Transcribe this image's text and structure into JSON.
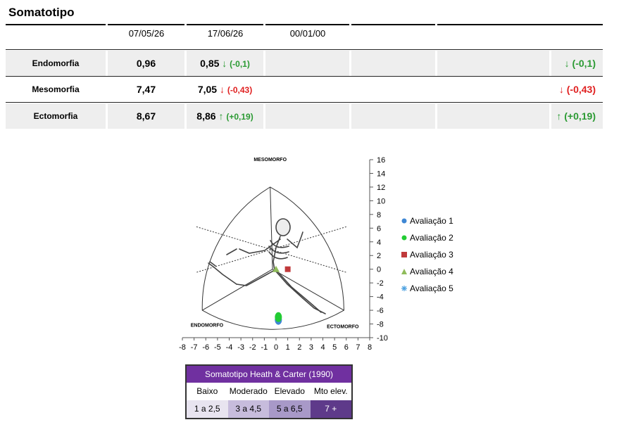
{
  "title": "Somatotipo",
  "dates": [
    "07/05/26",
    "17/06/26",
    "00/01/00"
  ],
  "rows": [
    {
      "label": "Endomorfia",
      "v1": "0,96",
      "v2": "0,85",
      "v2_arrow": "↓",
      "v2_delta": "(-0,1)",
      "final_arrow": "↓",
      "final_delta": "(-0,1)"
    },
    {
      "label": "Mesomorfia",
      "v1": "7,47",
      "v2": "7,05",
      "v2_arrow": "↓",
      "v2_delta": "(-0,43)",
      "final_arrow": "↓",
      "final_delta": "(-0,43)"
    },
    {
      "label": "Ectomorfia",
      "v1": "8,67",
      "v2": "8,86",
      "v2_arrow": "↑",
      "v2_delta": "(+0,19)",
      "final_arrow": "↑",
      "final_delta": "(+0,19)"
    }
  ],
  "colors": {
    "green": "#2a9a32",
    "red": "#e02020",
    "purple": "#7030a0"
  },
  "chart_data": {
    "type": "scatter",
    "xlim": [
      -8,
      8
    ],
    "ylim": [
      -10,
      16
    ],
    "x_ticks": [
      "-8",
      "-7",
      "-6",
      "-5",
      "-4",
      "-3",
      "-2",
      "-1",
      "0",
      "1",
      "2",
      "3",
      "4",
      "5",
      "6",
      "7",
      "8"
    ],
    "y_ticks": [
      "16",
      "14",
      "12",
      "10",
      "8",
      "6",
      "4",
      "2",
      "0",
      "-2",
      "-4",
      "-6",
      "-8",
      "-10"
    ],
    "corner_labels": {
      "top": "MESOMORFO",
      "left": "ENDOMORFO",
      "right": "ECTOMORFO"
    },
    "series": [
      {
        "name": "Avaliação 1",
        "color": "#3f87d4",
        "marker": "circle",
        "points": [
          [
            0.2,
            -7.4
          ]
        ]
      },
      {
        "name": "Avaliação 2",
        "color": "#22cc33",
        "marker": "circle",
        "points": [
          [
            0.2,
            -7.0
          ]
        ]
      },
      {
        "name": "Avaliação 3",
        "color": "#c0393b",
        "marker": "square",
        "points": [
          [
            1.0,
            0.0
          ]
        ]
      },
      {
        "name": "Avaliação 4",
        "color": "#8fbc5a",
        "marker": "triangle",
        "points": [
          [
            0.0,
            0.0
          ]
        ]
      },
      {
        "name": "Avaliação 5",
        "color": "#4aa0e0",
        "marker": "star",
        "points": []
      }
    ],
    "grid": false,
    "legend_position": "right"
  },
  "reference": {
    "title": "Somatotipo Heath & Carter (1990)",
    "levels": [
      "Baixo",
      "Moderado",
      "Elevado",
      "Mto elev."
    ],
    "ranges": [
      "1 a 2,5",
      "3 a 4,5",
      "5 a 6,5",
      "7 +"
    ],
    "range_colors": [
      "#e8e4f0",
      "#c7bcdc",
      "#a899c8",
      "#5e3a8a"
    ]
  }
}
